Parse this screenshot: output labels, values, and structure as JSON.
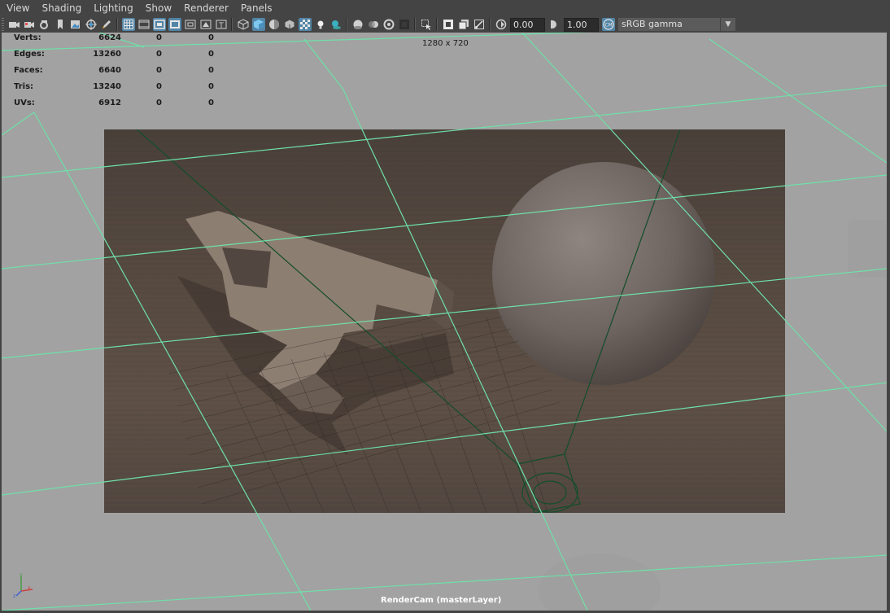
{
  "menu": [
    "View",
    "Shading",
    "Lighting",
    "Show",
    "Renderer",
    "Panels"
  ],
  "toolbar": {
    "exposure": "0.00",
    "gamma": "1.00",
    "color_space": "sRGB gamma"
  },
  "stats": [
    {
      "label": "Verts:",
      "v1": "6624",
      "v2": "0",
      "v3": "0"
    },
    {
      "label": "Edges:",
      "v1": "13260",
      "v2": "0",
      "v3": "0"
    },
    {
      "label": "Faces:",
      "v1": "6640",
      "v2": "0",
      "v3": "0"
    },
    {
      "label": "Tris:",
      "v1": "13240",
      "v2": "0",
      "v3": "0"
    },
    {
      "label": "UVs:",
      "v1": "6912",
      "v2": "0",
      "v3": "0"
    }
  ],
  "viewport": {
    "resolution": "1280 x 720",
    "camera": "RenderCam (masterLayer)"
  },
  "colors": {
    "grid": "#6ee0a8",
    "active_icon": "#5285a6",
    "viewport_bg": "#a2a2a2"
  }
}
